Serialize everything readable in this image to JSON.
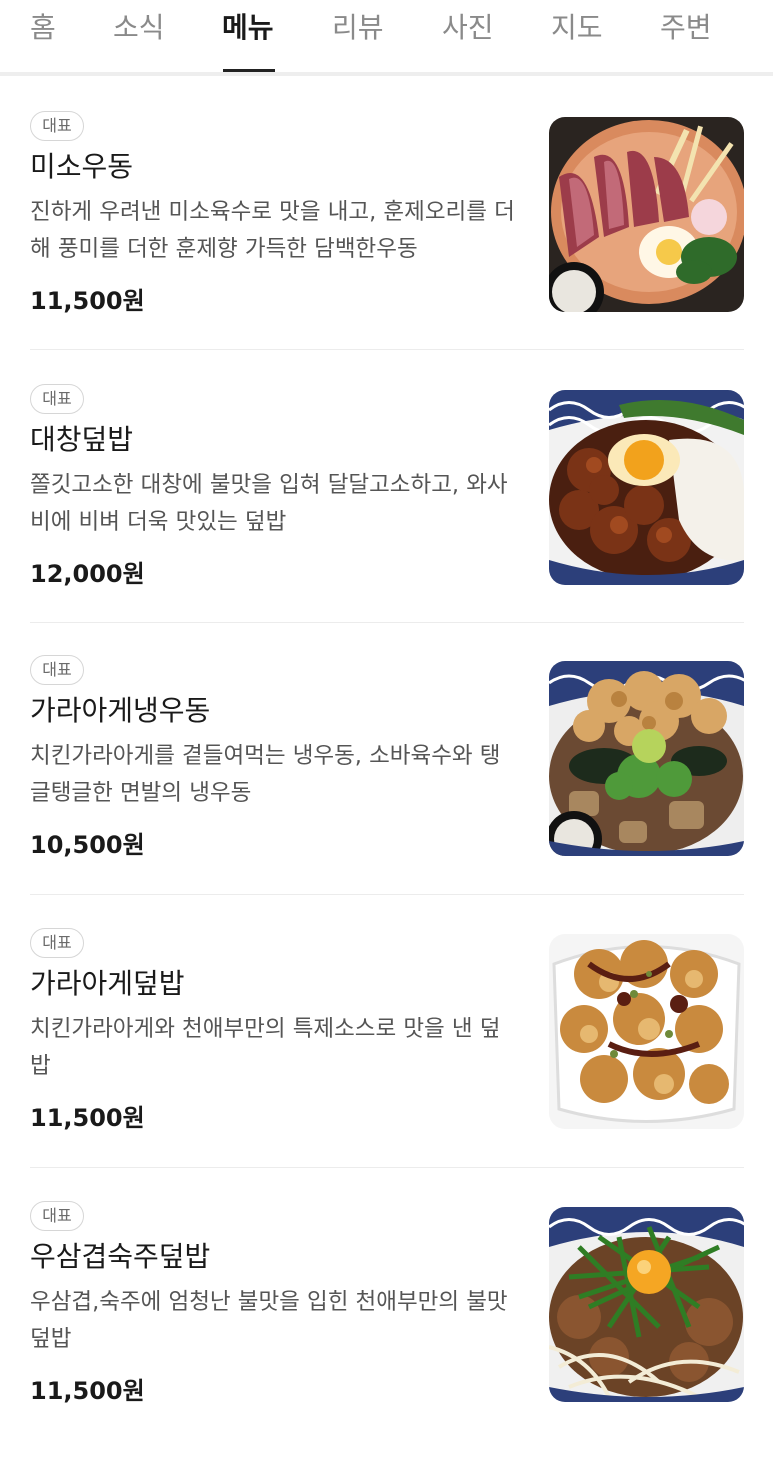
{
  "tabs": [
    "홈",
    "소식",
    "메뉴",
    "리뷰",
    "사진",
    "지도",
    "주변"
  ],
  "active_tab": "메뉴",
  "badge_label": "대표",
  "menu_items": [
    {
      "name": "미소우동",
      "description": "진하게 우려낸 미소육수로 맛을 내고, 훈제오리를 더해 풍미를 더한 훈제향 가득한 담백한우동",
      "price": "11,500원",
      "photo": "miso-udon-photo"
    },
    {
      "name": "대창덮밥",
      "description": "쫄깃고소한 대창에 불맛을 입혀 달달고소하고, 와사비에 비벼 더욱 맛있는 덮밥",
      "price": "12,000원",
      "photo": "daechang-rice-bowl-photo"
    },
    {
      "name": "가라아게냉우동",
      "description": "치킨가라아게를 곁들여먹는 냉우동, 소바육수와 탱글탱글한 면발의 냉우동",
      "price": "10,500원",
      "photo": "karaage-cold-udon-photo"
    },
    {
      "name": "가라아게덮밥",
      "description": "치킨가라아게와 천애부만의 특제소스로 맛을 낸 덮밥",
      "price": "11,500원",
      "photo": "karaage-rice-bowl-photo"
    },
    {
      "name": "우삼겹숙주덮밥",
      "description": "우삼겹,숙주에 엄청난 불맛을 입힌 천애부만의 불맛덮밥",
      "price": "11,500원",
      "photo": "beef-bean-sprout-rice-bowl-photo"
    }
  ]
}
